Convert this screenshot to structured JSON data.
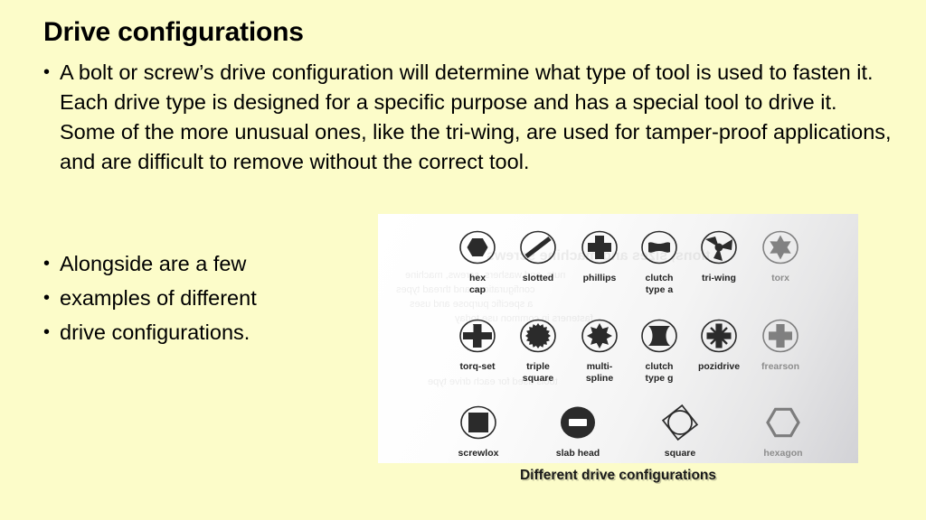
{
  "slide": {
    "title": "Drive configurations",
    "background_color": "#fcfcc9",
    "bullet_glyph": "•"
  },
  "intro": {
    "bullet": "A bolt or screw’s drive configuration will determine what type of tool is used to fasten it.  Each drive type is designed for a specific purpose and has a special tool to drive it.  Some of the more unusual ones, like the tri-wing, are used for tamper-proof applications, and are difficult to remove without the correct tool."
  },
  "side_bullets": [
    "Alongside are a few",
    "examples of different",
    "drive configurations."
  ],
  "figure": {
    "caption": "Different drive configurations",
    "ghost_text": {
      "line1": "tions, sizes and machine screws",
      "line2": "nuts, and washers, screws, machine",
      "line3": "configurations and thread types",
      "line4": "a specific purpose and uses",
      "line5": "fasteners in common use today",
      "line6": "tools used for each drive type"
    },
    "rows": [
      {
        "cells": [
          {
            "label": "hex\ncap",
            "icon": "hex-cap-drive-icon",
            "faded": false
          },
          {
            "label": "slotted",
            "icon": "slotted-drive-icon",
            "faded": false
          },
          {
            "label": "phillips",
            "icon": "phillips-drive-icon",
            "faded": false
          },
          {
            "label": "clutch\ntype a",
            "icon": "clutch-type-a-drive-icon",
            "faded": false
          },
          {
            "label": "tri-wing",
            "icon": "tri-wing-drive-icon",
            "faded": false
          },
          {
            "label": "torx",
            "icon": "torx-drive-icon",
            "faded": true
          }
        ]
      },
      {
        "cells": [
          {
            "label": "torq-set",
            "icon": "torq-set-drive-icon",
            "faded": false
          },
          {
            "label": "triple\nsquare",
            "icon": "triple-square-drive-icon",
            "faded": false
          },
          {
            "label": "multi-\nspline",
            "icon": "multi-spline-drive-icon",
            "faded": false
          },
          {
            "label": "clutch\ntype g",
            "icon": "clutch-type-g-drive-icon",
            "faded": false
          },
          {
            "label": "pozidrive",
            "icon": "pozidrive-drive-icon",
            "faded": false
          },
          {
            "label": "frearson",
            "icon": "frearson-drive-icon",
            "faded": true
          }
        ]
      },
      {
        "cells": [
          {
            "label": "screwlox",
            "icon": "screwlox-drive-icon",
            "faded": false
          },
          {
            "label": "slab head",
            "icon": "slab-head-drive-icon",
            "faded": false
          },
          {
            "label": "square",
            "icon": "square-drive-icon",
            "faded": false
          },
          {
            "label": "hexagon",
            "icon": "hexagon-drive-icon",
            "faded": true
          }
        ]
      }
    ]
  }
}
